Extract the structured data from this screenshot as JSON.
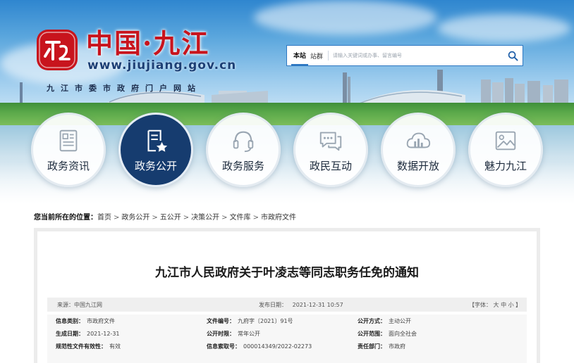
{
  "site": {
    "title": "中国·九江",
    "url": "www.jiujiang.gov.cn",
    "subtitle": "九江市委市政府门户网站"
  },
  "search": {
    "tabs": [
      "本站",
      "站群"
    ],
    "placeholder": "请输入关键词或办事、留言编号"
  },
  "nav": {
    "items": [
      {
        "label": "政务资讯",
        "icon": "news-document-icon"
      },
      {
        "label": "政务公开",
        "icon": "document-star-icon"
      },
      {
        "label": "政务服务",
        "icon": "headset-icon"
      },
      {
        "label": "政民互动",
        "icon": "chat-bubbles-icon"
      },
      {
        "label": "数据开放",
        "icon": "cloud-chart-icon"
      },
      {
        "label": "魅力九江",
        "icon": "picture-icon"
      }
    ],
    "active_index": 1
  },
  "breadcrumb": {
    "lead": "您当前所在的位置：",
    "items": [
      "首页",
      "政务公开",
      "五公开",
      "决策公开",
      "文件库",
      "市政府文件"
    ]
  },
  "article": {
    "title": "九江市人民政府关于叶凌志等同志职务任免的通知",
    "source": "来源：中国九江网",
    "publish_date": "发布日期：   2021-12-31 10:57",
    "font_size_label": "【字体： 大 中 小 】"
  },
  "meta": {
    "rows": [
      [
        {
          "key": "信息类别：",
          "value": "市政府文件"
        },
        {
          "key": "文件编号：",
          "value": "九府字〔2021〕91号"
        },
        {
          "key": "公开方式：",
          "value": "主动公开"
        }
      ],
      [
        {
          "key": "生成日期：",
          "value": "2021-12-31"
        },
        {
          "key": "公开时限：",
          "value": "常年公开"
        },
        {
          "key": "公开范围：",
          "value": "面向全社会"
        }
      ],
      [
        {
          "key": "规范性文件有效性：",
          "value": "有效"
        },
        {
          "key": "信息索取号：",
          "value": "000014349/2022-02273"
        },
        {
          "key": "责任部门：",
          "value": "市政府"
        }
      ]
    ]
  },
  "colors": {
    "brand_red": "#c8141d",
    "nav_active": "#163c6f",
    "search_border": "#2e78c2"
  }
}
